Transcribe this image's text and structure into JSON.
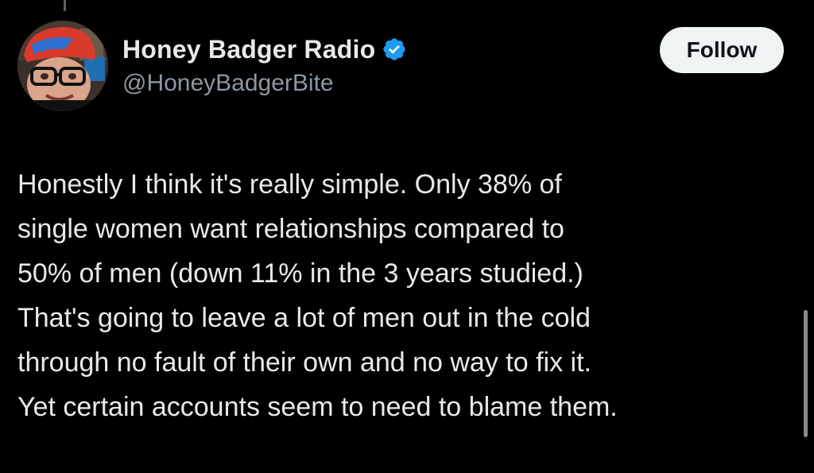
{
  "tweet": {
    "author": {
      "display_name": "Honey Badger Radio",
      "handle": "@HoneyBadgerBite",
      "verified": true,
      "avatar_icon": "profile-photo"
    },
    "follow_label": "Follow",
    "text_lines": [
      "Honestly I think it's really simple. Only 38% of",
      "single women want relationships compared to",
      "50% of men (down 11% in the 3 years studied.)",
      "That's going to leave a lot of men out in the cold",
      "through no fault of their own and no way to fix it.",
      "Yet certain accounts seem to need to blame them."
    ]
  },
  "colors": {
    "background": "#000000",
    "text_primary": "#e7e9ea",
    "text_secondary": "#8b98a5",
    "verified_badge": "#1d9bf0",
    "follow_button_bg": "#eff3f4",
    "follow_button_text": "#0f1419"
  }
}
